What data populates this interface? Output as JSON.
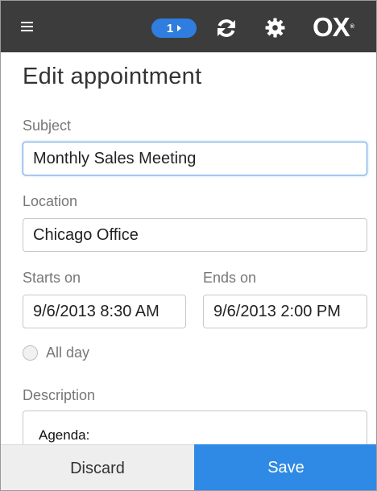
{
  "topbar": {
    "menu_icon": "hamburger-menu-icon",
    "counter": "1",
    "refresh_icon": "refresh-icon",
    "settings_icon": "gear-icon",
    "logo": "OX",
    "background_color": "#3c3c3c",
    "accent_color": "#2f7ddf"
  },
  "page": {
    "title": "Edit appointment"
  },
  "form": {
    "subject_label": "Subject",
    "subject_value": "Monthly Sales Meeting",
    "location_label": "Location",
    "location_value": "Chicago Office",
    "starts_label": "Starts on",
    "starts_value": "9/6/2013 8:30 AM",
    "ends_label": "Ends on",
    "ends_value": "9/6/2013 2:00 PM",
    "allday_label": "All day",
    "allday_checked": false,
    "description_label": "Description",
    "description_value": "Agenda:"
  },
  "actions": {
    "discard_label": "Discard",
    "save_label": "Save",
    "save_color": "#2f8ae5"
  }
}
